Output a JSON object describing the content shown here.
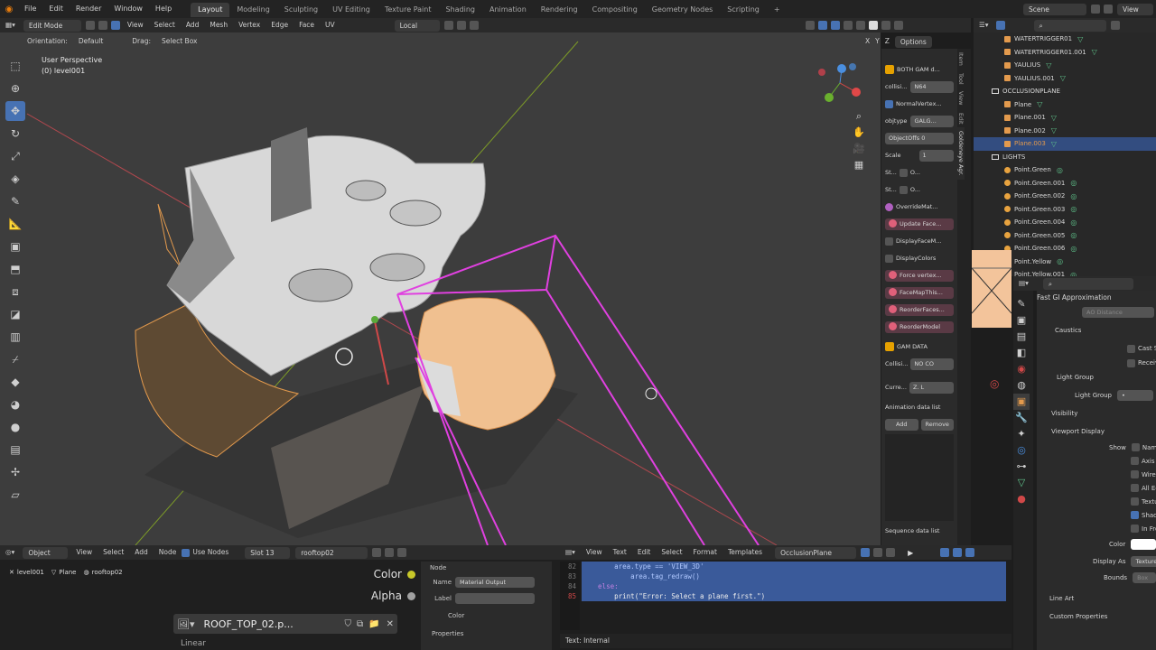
{
  "topbar": {
    "menu": [
      "File",
      "Edit",
      "Render",
      "Window",
      "Help"
    ],
    "workspaces": [
      "Layout",
      "Modeling",
      "Sculpting",
      "UV Editing",
      "Texture Paint",
      "Shading",
      "Animation",
      "Rendering",
      "Compositing",
      "Geometry Nodes",
      "Scripting"
    ],
    "active_workspace": "Layout",
    "add_tab": "+",
    "scene": "Scene",
    "view_layer": "View"
  },
  "viewport_header": {
    "mode": "Edit Mode",
    "menus": [
      "View",
      "Select",
      "Add",
      "Mesh",
      "Vertex",
      "Edge",
      "Face",
      "UV"
    ],
    "transform_orientation": "Local",
    "orientation_label": "Orientation:",
    "orientation_value": "Default",
    "drag_label": "Drag:",
    "drag_value": "Select Box",
    "axes": [
      "X",
      "Y",
      "Z"
    ],
    "options": "Options"
  },
  "viewport": {
    "perspective": "User Perspective",
    "object": "(0) level001"
  },
  "npanel": {
    "header": "BOTH GAM d...",
    "collision": "N64",
    "collision_label": "collisi...",
    "normal_vertex": "NormalVertex...",
    "objtype_label": "objtype",
    "objtype": "GALG...",
    "objectoffs": "ObjectOffs",
    "objectoffs_val": "0",
    "scale_label": "Scale",
    "scale_val": "1",
    "st1": "St...",
    "st2": "St...",
    "o": "O...",
    "override": "OverrideMat...",
    "update_face": "Update Face...",
    "display_face": "DisplayFaceM...",
    "display_colors": "DisplayColors",
    "force_vertex": "Force vertex...",
    "face_map": "FaceMapThis...",
    "reorder_faces": "ReorderFaces...",
    "reorder_model": "ReorderModel",
    "gam_data": "GAM DATA",
    "collision_type_label": "Collisi...",
    "collision_type": "NO CO",
    "current_label": "Curre...",
    "current_val": "Z. L",
    "anim_list": "Animation data list",
    "add": "Add",
    "remove": "Remove",
    "sequence_list": "Sequence data list",
    "tabs": [
      "Item",
      "Tool",
      "View",
      "Edit",
      "Goldeneye Agr."
    ]
  },
  "outliner": {
    "rows": [
      {
        "name": "WATERTRIGGER01",
        "indent": 2,
        "kind": "obj"
      },
      {
        "name": "WATERTRIGGER01.001",
        "indent": 2,
        "kind": "obj"
      },
      {
        "name": "YAULIUS",
        "indent": 2,
        "kind": "obj"
      },
      {
        "name": "YAULIUS.001",
        "indent": 2,
        "kind": "obj"
      },
      {
        "name": "OCCLUSIONPLANE",
        "indent": 1,
        "kind": "col"
      },
      {
        "name": "Plane",
        "indent": 2,
        "kind": "obj"
      },
      {
        "name": "Plane.001",
        "indent": 2,
        "kind": "obj"
      },
      {
        "name": "Plane.002",
        "indent": 2,
        "kind": "obj"
      },
      {
        "name": "Plane.003",
        "indent": 2,
        "kind": "obj",
        "selected": true
      },
      {
        "name": "LIGHTS",
        "indent": 1,
        "kind": "col"
      },
      {
        "name": "Point.Green",
        "indent": 2,
        "kind": "light"
      },
      {
        "name": "Point.Green.001",
        "indent": 2,
        "kind": "light"
      },
      {
        "name": "Point.Green.002",
        "indent": 2,
        "kind": "light"
      },
      {
        "name": "Point.Green.003",
        "indent": 2,
        "kind": "light"
      },
      {
        "name": "Point.Green.004",
        "indent": 2,
        "kind": "light"
      },
      {
        "name": "Point.Green.005",
        "indent": 2,
        "kind": "light"
      },
      {
        "name": "Point.Green.006",
        "indent": 2,
        "kind": "light"
      },
      {
        "name": "Point.Yellow",
        "indent": 2,
        "kind": "light"
      },
      {
        "name": "Point.Yellow.001",
        "indent": 2,
        "kind": "light"
      }
    ]
  },
  "properties": {
    "fast_gi": "Fast GI Approximation",
    "ao_distance": "AO Distance",
    "caustics": "Caustics",
    "cast_shadow": "Cast S",
    "receive": "Receiv",
    "light_group_section": "Light Group",
    "light_group_label": "Light Group",
    "light_group_val": "•",
    "visibility": "Visibility",
    "viewport_display": "Viewport Display",
    "show_label": "Show",
    "show_name": "Name",
    "axis": "Axis",
    "wireframe": "Wirefra",
    "all_edges": "All Edge",
    "texture": "Texture",
    "shadow": "Shadow",
    "in_front": "In Front",
    "color_label": "Color",
    "display_as_label": "Display As",
    "display_as": "Textured",
    "bounds_label": "Bounds",
    "bounds_val": "Box",
    "line_art": "Line Art",
    "custom_props": "Custom Properties"
  },
  "node_editor": {
    "type": "Object",
    "menus": [
      "View",
      "Select",
      "Add",
      "Node"
    ],
    "use_nodes": "Use Nodes",
    "slot": "Slot 13",
    "material": "rooftop02",
    "breadcrumb": [
      "level001",
      "Plane",
      "rooftop02"
    ],
    "color_socket": "Color",
    "alpha_socket": "Alpha",
    "image_name": "ROOF_TOP_02.p...",
    "node_tab": "Node",
    "name_label": "Name",
    "name_val": "Material Output",
    "label_label": "Label",
    "color_section": "Color",
    "properties_section": "Properties",
    "partial_node": "Linear"
  },
  "text_editor": {
    "menus": [
      "View",
      "Text",
      "Edit",
      "Select",
      "Format",
      "Templates"
    ],
    "file": "OcclusionPlane",
    "line_numbers": [
      "82",
      "83",
      "84",
      "85"
    ],
    "lines": [
      "        area.type == 'VIEW_3D'",
      "            area.tag_redraw()",
      "    else:",
      "        print(\"Error: Select a plane first.\")"
    ],
    "status": "Text: Internal"
  },
  "colors": {
    "accent": "#4772b3",
    "magenta": "#e040e0",
    "orange": "#e39a4d",
    "selection": "#334d80"
  }
}
